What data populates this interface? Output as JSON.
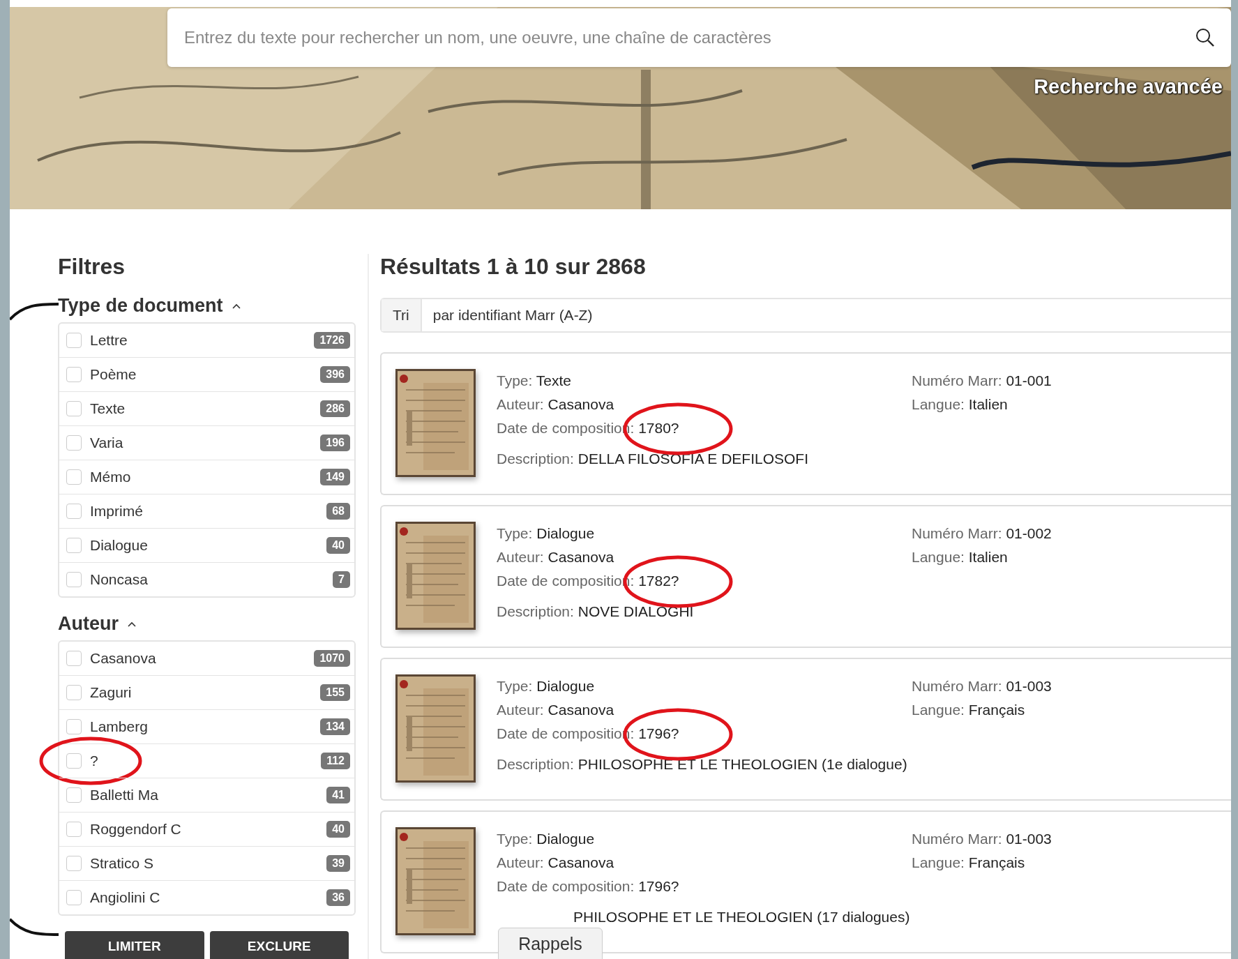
{
  "search": {
    "placeholder": "Entrez du texte pour rechercher un nom, une oeuvre, une chaîne de caractères"
  },
  "advanced_search": "Recherche avancée",
  "filters": {
    "title": "Filtres",
    "bracketed": true,
    "groups": [
      {
        "title": "Type de document",
        "expanded": true,
        "items": [
          {
            "label": "Lettre",
            "count": "1726",
            "checked": false,
            "circled": false
          },
          {
            "label": "Poème",
            "count": "396",
            "checked": false,
            "circled": false
          },
          {
            "label": "Texte",
            "count": "286",
            "checked": false,
            "circled": false
          },
          {
            "label": "Varia",
            "count": "196",
            "checked": false,
            "circled": false
          },
          {
            "label": "Mémo",
            "count": "149",
            "checked": false,
            "circled": false
          },
          {
            "label": "Imprimé",
            "count": "68",
            "checked": false,
            "circled": false
          },
          {
            "label": "Dialogue",
            "count": "40",
            "checked": false,
            "circled": false
          },
          {
            "label": "Noncasa",
            "count": "7",
            "checked": false,
            "circled": false
          }
        ]
      },
      {
        "title": "Auteur",
        "expanded": true,
        "items": [
          {
            "label": "Casanova",
            "count": "1070",
            "checked": false,
            "circled": false
          },
          {
            "label": "Zaguri",
            "count": "155",
            "checked": false,
            "circled": false
          },
          {
            "label": "Lamberg",
            "count": "134",
            "checked": false,
            "circled": false
          },
          {
            "label": "?",
            "count": "112",
            "checked": false,
            "circled": true
          },
          {
            "label": "Balletti Ma",
            "count": "41",
            "checked": false,
            "circled": false
          },
          {
            "label": "Roggendorf C",
            "count": "40",
            "checked": false,
            "circled": false
          },
          {
            "label": "Stratico S",
            "count": "39",
            "checked": false,
            "circled": false
          },
          {
            "label": "Angiolini C",
            "count": "36",
            "checked": false,
            "circled": false
          }
        ]
      }
    ],
    "buttons": [
      "LIMITER",
      "EXCLURE"
    ]
  },
  "results": {
    "title": "Résultats 1 à 10 sur 2868",
    "sort": {
      "label": "Tri",
      "value": "par identifiant Marr (A-Z)"
    },
    "cards": [
      {
        "left": [
          {
            "label": "Type:",
            "value": "Texte",
            "circled": false
          },
          {
            "label": "Auteur:",
            "value": "Casanova",
            "circled": false
          },
          {
            "label": "Date de composition:",
            "value": "1780?",
            "circled": true
          }
        ],
        "description": {
          "label": "Description:",
          "value": "DELLA FILOSOFIA E DEFILOSOFI"
        },
        "right": [
          {
            "label": "Numéro Marr:",
            "value": "01-001"
          },
          {
            "label": "Langue:",
            "value": "Italien"
          }
        ]
      },
      {
        "left": [
          {
            "label": "Type:",
            "value": "Dialogue",
            "circled": false
          },
          {
            "label": "Auteur:",
            "value": "Casanova",
            "circled": false
          },
          {
            "label": "Date de composition:",
            "value": "1782?",
            "circled": true
          }
        ],
        "description": {
          "label": "Description:",
          "value": "NOVE DIALOGHI"
        },
        "right": [
          {
            "label": "Numéro Marr:",
            "value": "01-002"
          },
          {
            "label": "Langue:",
            "value": "Italien"
          }
        ]
      },
      {
        "left": [
          {
            "label": "Type:",
            "value": "Dialogue",
            "circled": false
          },
          {
            "label": "Auteur:",
            "value": "Casanova",
            "circled": false
          },
          {
            "label": "Date de composition:",
            "value": "1796?",
            "circled": true
          }
        ],
        "description": {
          "label": "Description:",
          "value": "PHILOSOPHE ET LE THEOLOGIEN (1e dialogue)"
        },
        "right": [
          {
            "label": "Numéro Marr:",
            "value": "01-003"
          },
          {
            "label": "Langue:",
            "value": "Français"
          }
        ]
      },
      {
        "left": [
          {
            "label": "Type:",
            "value": "Dialogue",
            "circled": false
          },
          {
            "label": "Auteur:",
            "value": "Casanova",
            "circled": false
          },
          {
            "label": "Date de composition:",
            "value": "1796?",
            "circled": false
          }
        ],
        "description": {
          "value": "PHILOSOPHE ET LE THEOLOGIEN (17 dialogues)"
        },
        "right": [
          {
            "label": "Numéro Marr:",
            "value": "01-003"
          },
          {
            "label": "Langue:",
            "value": "Français"
          }
        ]
      }
    ]
  },
  "reminder_tab": "Rappels"
}
